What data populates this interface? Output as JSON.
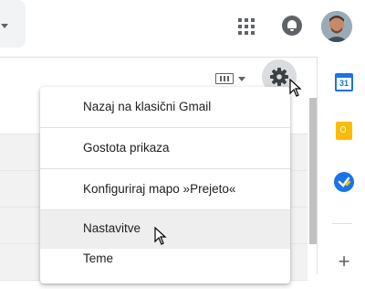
{
  "menu": {
    "items": [
      {
        "label": "Nazaj na klasični Gmail"
      },
      {
        "label": "Gostota prikaza"
      },
      {
        "label": "Konfiguriraj mapo »Prejeto«"
      },
      {
        "label": "Nastavitve"
      },
      {
        "label": "Teme"
      }
    ],
    "hovered_index": 3
  },
  "side_panel": {
    "calendar_day": "31"
  },
  "colors": {
    "accent": "#1a73e8",
    "keep": "#fbbc04",
    "hover": "#eeeeee"
  },
  "icons": [
    "apps-icon",
    "notifications-bell-icon",
    "keyboard-icon",
    "settings-gear-icon",
    "calendar-icon",
    "keep-icon",
    "tasks-icon",
    "plus-icon"
  ]
}
